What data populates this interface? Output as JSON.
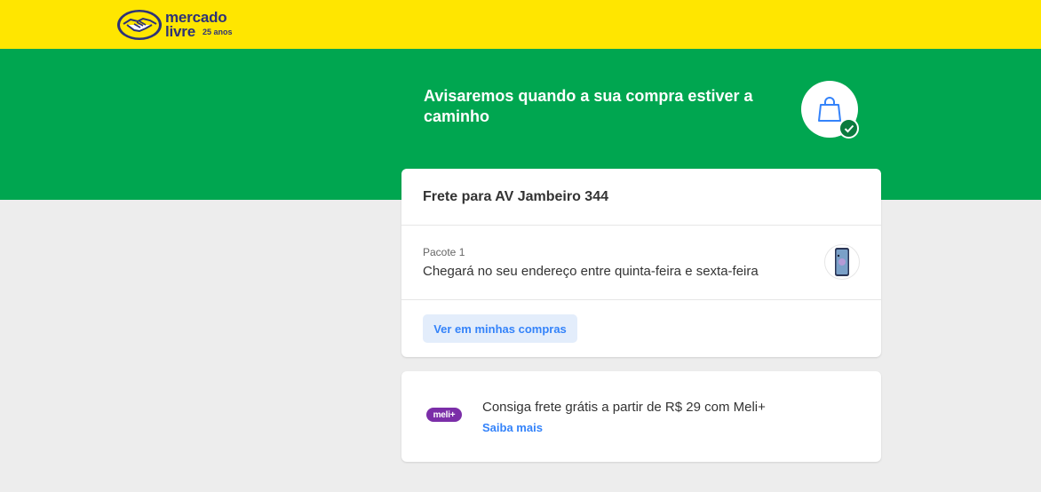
{
  "header": {
    "logo_line1": "mercado",
    "logo_line2": "livre",
    "logo_anniversary": "25 anos",
    "brand_color": "#ffe600"
  },
  "hero": {
    "title": "Avisaremos quando a sua compra estiver a caminho",
    "background": "#00a650",
    "icon": "shopping-bag-icon",
    "badge_icon": "check-icon"
  },
  "shipping": {
    "title": "Frete para AV  Jambeiro 344",
    "package_label": "Pacote 1",
    "package_description": "Chegará no seu endereço entre quinta-feira e sexta-feira",
    "product_thumbnail_icon": "smartphone-icon",
    "button_label": "Ver em minhas compras"
  },
  "meli_plus": {
    "badge": "meli+",
    "text": "Consiga frete grátis a partir de R$ 29 com Meli+",
    "link_label": "Saiba mais"
  }
}
